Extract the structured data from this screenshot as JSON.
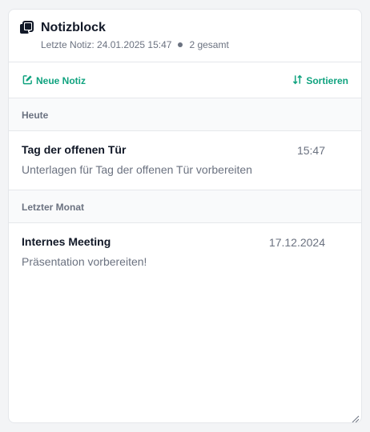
{
  "header": {
    "title": "Notizblock",
    "last_note_label": "Letzte Notiz: 24.01.2025 15:47",
    "count_label": "2 gesamt",
    "icon": "notes-stack-icon"
  },
  "toolbar": {
    "new_note_label": "Neue Notiz",
    "sort_label": "Sortieren",
    "new_note_icon": "edit-icon",
    "sort_icon": "sort-icon"
  },
  "groups": [
    {
      "label": "Heute",
      "notes": [
        {
          "title": "Tag der offenen Tür",
          "date": "15:47",
          "preview": "Unterlagen für Tag der offenen Tür vorbereiten"
        }
      ]
    },
    {
      "label": "Letzter Monat",
      "notes": [
        {
          "title": "Internes Meeting",
          "date": "17.12.2024",
          "preview": "Präsentation vorbereiten!"
        }
      ]
    }
  ],
  "colors": {
    "accent": "#10a37f",
    "muted": "#6b7280",
    "border": "#e5e7eb"
  }
}
